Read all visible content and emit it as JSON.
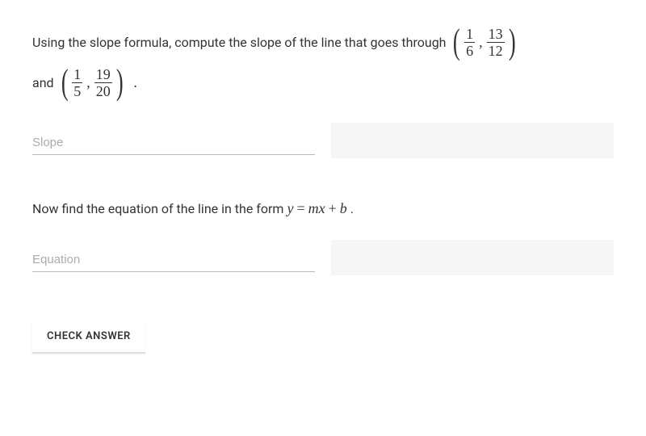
{
  "q1": {
    "prefix": "Using the slope formula, compute the slope of the line that goes through",
    "and": "and",
    "point1": {
      "x_num": "1",
      "x_den": "6",
      "y_num": "13",
      "y_den": "12"
    },
    "point2": {
      "x_num": "1",
      "x_den": "5",
      "y_num": "19",
      "y_den": "20"
    },
    "input_placeholder": "Slope"
  },
  "q2": {
    "prefix": "Now find the equation of the line in the form",
    "eq_y": "y",
    "eq_eq": "=",
    "eq_m": "m",
    "eq_x": "x",
    "eq_plus": "+",
    "eq_b": "b",
    "period": ".",
    "input_placeholder": "Equation"
  },
  "check_button": "CHECK ANSWER"
}
